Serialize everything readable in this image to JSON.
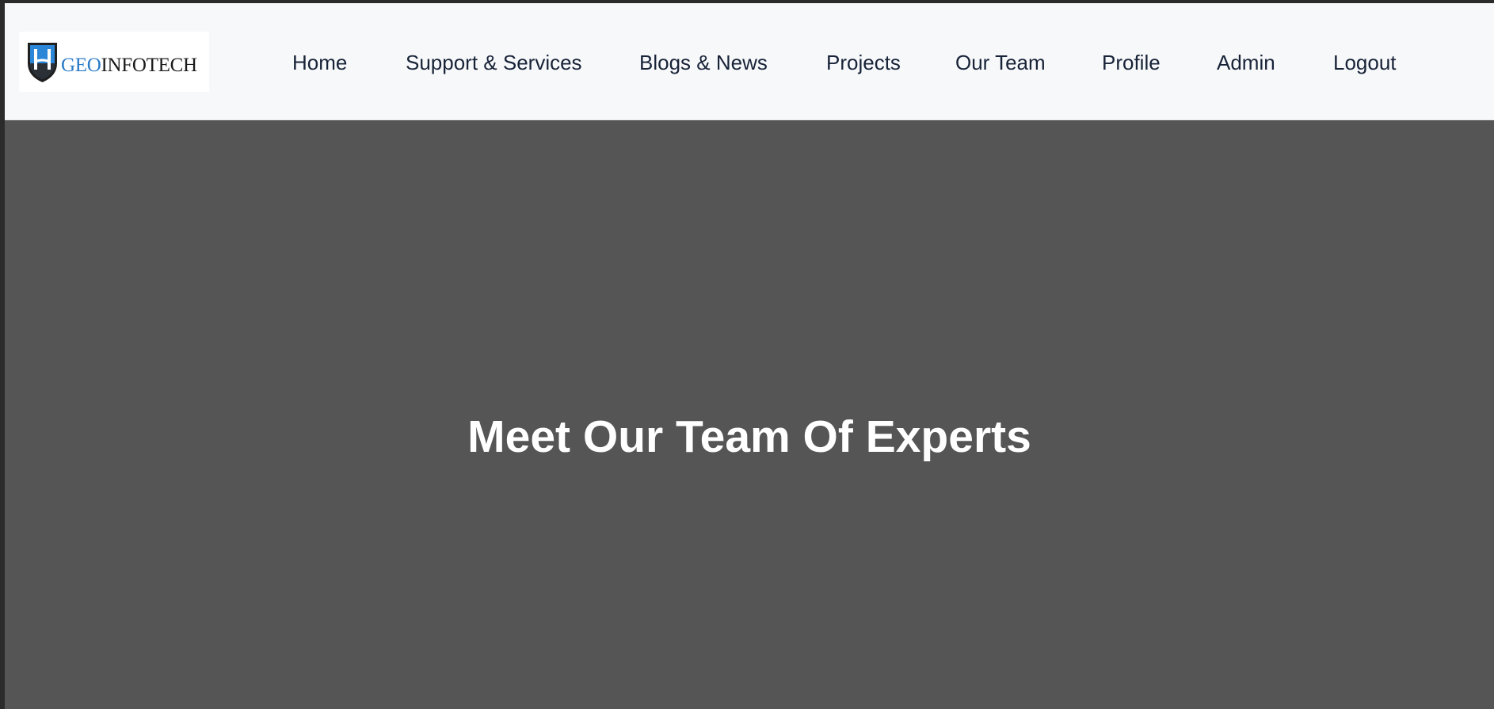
{
  "header": {
    "logo": {
      "text_part1": "GEO",
      "text_part2": "INFOTECH",
      "icon": "shield-h-logo-icon",
      "accent_color": "#2a7ac7"
    },
    "nav": [
      {
        "label": "Home"
      },
      {
        "label": "Support & Services"
      },
      {
        "label": "Blogs & News"
      },
      {
        "label": "Projects"
      },
      {
        "label": "Our Team"
      },
      {
        "label": "Profile"
      },
      {
        "label": "Admin"
      },
      {
        "label": "Logout"
      }
    ]
  },
  "hero": {
    "title": "Meet Our Team Of Experts",
    "background_color": "#555555"
  },
  "colors": {
    "navbar_bg": "#f7f8fa",
    "nav_text": "#182338",
    "hero_text": "#ffffff"
  }
}
